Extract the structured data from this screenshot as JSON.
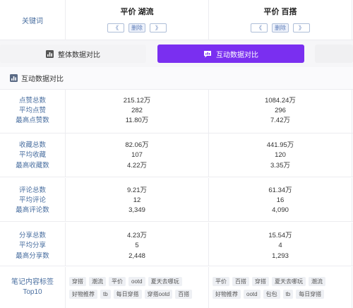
{
  "header": {
    "label": "关键词",
    "columns": [
      {
        "title": "平价 湖流",
        "prev": "《",
        "del": "删除",
        "next": "》"
      },
      {
        "title": "平价 百搭",
        "prev": "《",
        "del": "删除",
        "next": "》"
      }
    ]
  },
  "tabs": [
    {
      "label": "整体数据对比",
      "icon": "bar-chart-icon"
    },
    {
      "label": "互动数据对比",
      "icon": "chat-chart-icon",
      "active": true
    }
  ],
  "section": {
    "title": "互动数据对比",
    "icon": "bar-chart-icon"
  },
  "groups": [
    {
      "labels": [
        "点赞总数",
        "平均点赞",
        "最高点赞数"
      ],
      "c1": [
        "215.12万",
        "282",
        "11.80万"
      ],
      "c2": [
        "1084.24万",
        "296",
        "7.42万"
      ]
    },
    {
      "labels": [
        "收藏总数",
        "平均收藏",
        "最高收藏数"
      ],
      "c1": [
        "82.06万",
        "107",
        "4.22万"
      ],
      "c2": [
        "441.95万",
        "120",
        "3.35万"
      ]
    },
    {
      "labels": [
        "评论总数",
        "平均评论",
        "最高评论数"
      ],
      "c1": [
        "9.21万",
        "12",
        "3,349"
      ],
      "c2": [
        "61.34万",
        "16",
        "4,090"
      ]
    },
    {
      "labels": [
        "分享总数",
        "平均分享",
        "最高分享数"
      ],
      "c1": [
        "4.23万",
        "5",
        "2,448"
      ],
      "c2": [
        "15.54万",
        "4",
        "1,293"
      ]
    }
  ],
  "tags": {
    "label_line1": "笔记内容标签",
    "label_line2": "Top10",
    "c1": [
      "穿搭",
      "潮流",
      "平价",
      "ootd",
      "夏天去哪玩",
      "好物推荐",
      "tb",
      "每日穿搭",
      "穿搭ootd",
      "百搭"
    ],
    "c2": [
      "平价",
      "百搭",
      "穿搭",
      "夏天去哪玩",
      "潮流",
      "好物推荐",
      "ootd",
      "包包",
      "tb",
      "每日穿搭"
    ]
  },
  "colors": {
    "accent": "#7a2ff0",
    "label_blue": "#4a6fa0"
  }
}
